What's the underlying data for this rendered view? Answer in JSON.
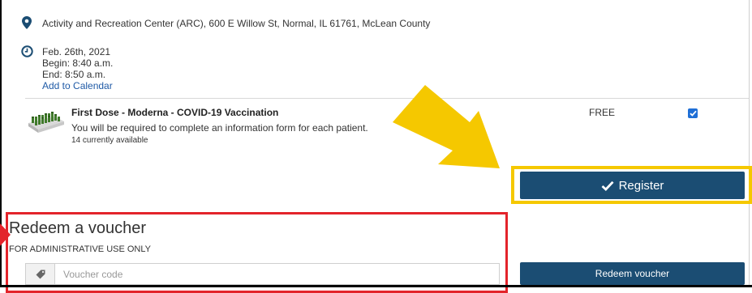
{
  "event": {
    "location": "Activity and Recreation Center (ARC), 600 E Willow St, Normal, IL 61761, McLean County",
    "date": "Feb. 26th, 2021",
    "begin": "Begin: 8:40 a.m.",
    "end": "End: 8:50 a.m.",
    "add_to_calendar": "Add to Calendar"
  },
  "product": {
    "title": "First Dose - Moderna - COVID-19 Vaccination",
    "description": "You will be required to complete an information form for each patient.",
    "availability": "14 currently available",
    "price": "FREE",
    "selected": true
  },
  "register": {
    "label": "Register"
  },
  "voucher": {
    "title": "Redeem a voucher",
    "subtitle": "FOR ADMINISTRATIVE USE ONLY",
    "placeholder": "Voucher code",
    "button_label": "Redeem voucher"
  },
  "colors": {
    "primary_button": "#1b4d73",
    "highlight_yellow": "#f5c800",
    "highlight_red": "#e3242b",
    "link": "#1f5aa6",
    "checkbox": "#1f6fd6"
  },
  "icons": {
    "location": "map-pin-icon",
    "time": "clock-icon",
    "check": "checkmark-icon",
    "voucher": "tag-icon"
  }
}
